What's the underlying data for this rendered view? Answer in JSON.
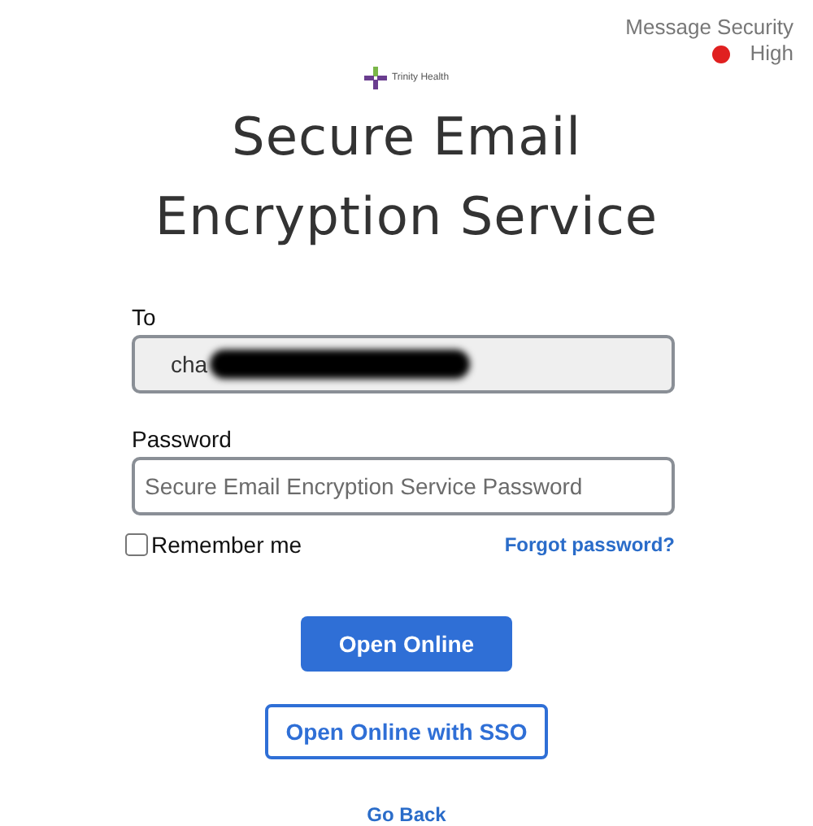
{
  "security": {
    "label": "Message Security",
    "level_text": "High",
    "color": "#e02020"
  },
  "logo": {
    "text": "Trinity Health"
  },
  "title": "Secure Email Encryption Service",
  "to": {
    "label": "To",
    "value": "cha",
    "redacted": true
  },
  "password": {
    "label": "Password",
    "placeholder": "Secure Email Encryption Service Password"
  },
  "remember": {
    "label": "Remember me",
    "checked": false
  },
  "forgot": "Forgot password?",
  "buttons": [
    {
      "label": "Open Online",
      "kind": "primary"
    },
    {
      "label": "Open Online with SSO",
      "kind": "outline"
    }
  ],
  "back": "Go Back"
}
